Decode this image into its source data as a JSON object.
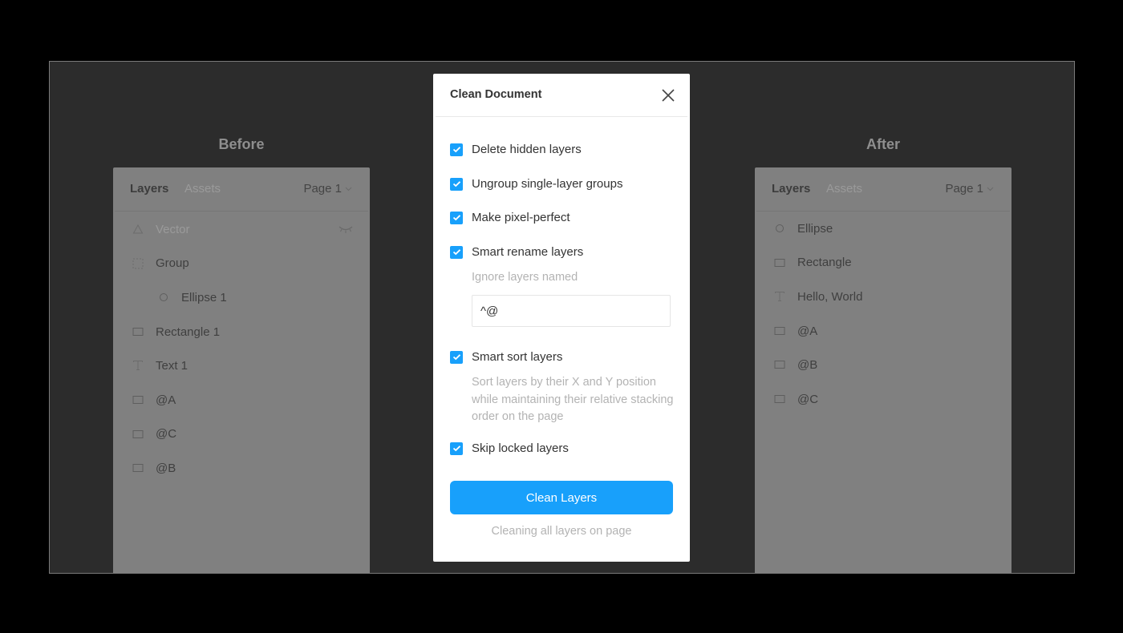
{
  "colors": {
    "accent": "#18a0fb",
    "backdrop": "#000000",
    "frame": "#2c2c2c",
    "panel": "#808080"
  },
  "before": {
    "title": "Before",
    "tabs": {
      "layers": "Layers",
      "assets": "Assets"
    },
    "page_select": "Page 1",
    "layers": [
      {
        "name": "Vector",
        "icon": "vector-icon",
        "hidden": true,
        "visibility_icon": "eye-closed-icon"
      },
      {
        "name": "Group",
        "icon": "group-frame-icon"
      },
      {
        "name": "Ellipse 1",
        "icon": "ellipse-icon",
        "indent": 1
      },
      {
        "name": "Rectangle 1",
        "icon": "rectangle-icon"
      },
      {
        "name": "Text 1",
        "icon": "text-icon"
      },
      {
        "name": "@A",
        "icon": "rectangle-icon"
      },
      {
        "name": "@C",
        "icon": "rectangle-icon"
      },
      {
        "name": "@B",
        "icon": "rectangle-icon"
      }
    ]
  },
  "after": {
    "title": "After",
    "tabs": {
      "layers": "Layers",
      "assets": "Assets"
    },
    "page_select": "Page 1",
    "layers": [
      {
        "name": "Ellipse",
        "icon": "ellipse-icon"
      },
      {
        "name": "Rectangle",
        "icon": "rectangle-icon"
      },
      {
        "name": "Hello, World",
        "icon": "text-icon"
      },
      {
        "name": "@A",
        "icon": "rectangle-icon"
      },
      {
        "name": "@B",
        "icon": "rectangle-icon"
      },
      {
        "name": "@C",
        "icon": "rectangle-icon"
      }
    ]
  },
  "modal": {
    "title": "Clean Document",
    "close_icon": "close-icon",
    "options": [
      {
        "label": "Delete hidden layers",
        "checked": true
      },
      {
        "label": "Ungroup single-layer groups",
        "checked": true
      },
      {
        "label": "Make pixel-perfect",
        "checked": true
      },
      {
        "label": "Smart rename layers",
        "checked": true
      },
      {
        "label": "Smart sort layers",
        "checked": true
      },
      {
        "label": "Skip locked layers",
        "checked": true
      }
    ],
    "rename_ignore_label": "Ignore layers named",
    "rename_ignore_value": "^@",
    "sort_description": "Sort layers by their X and Y position while maintaining their relative stacking order on the page",
    "primary_button": "Clean Layers",
    "footer_note": "Cleaning all layers on page"
  }
}
